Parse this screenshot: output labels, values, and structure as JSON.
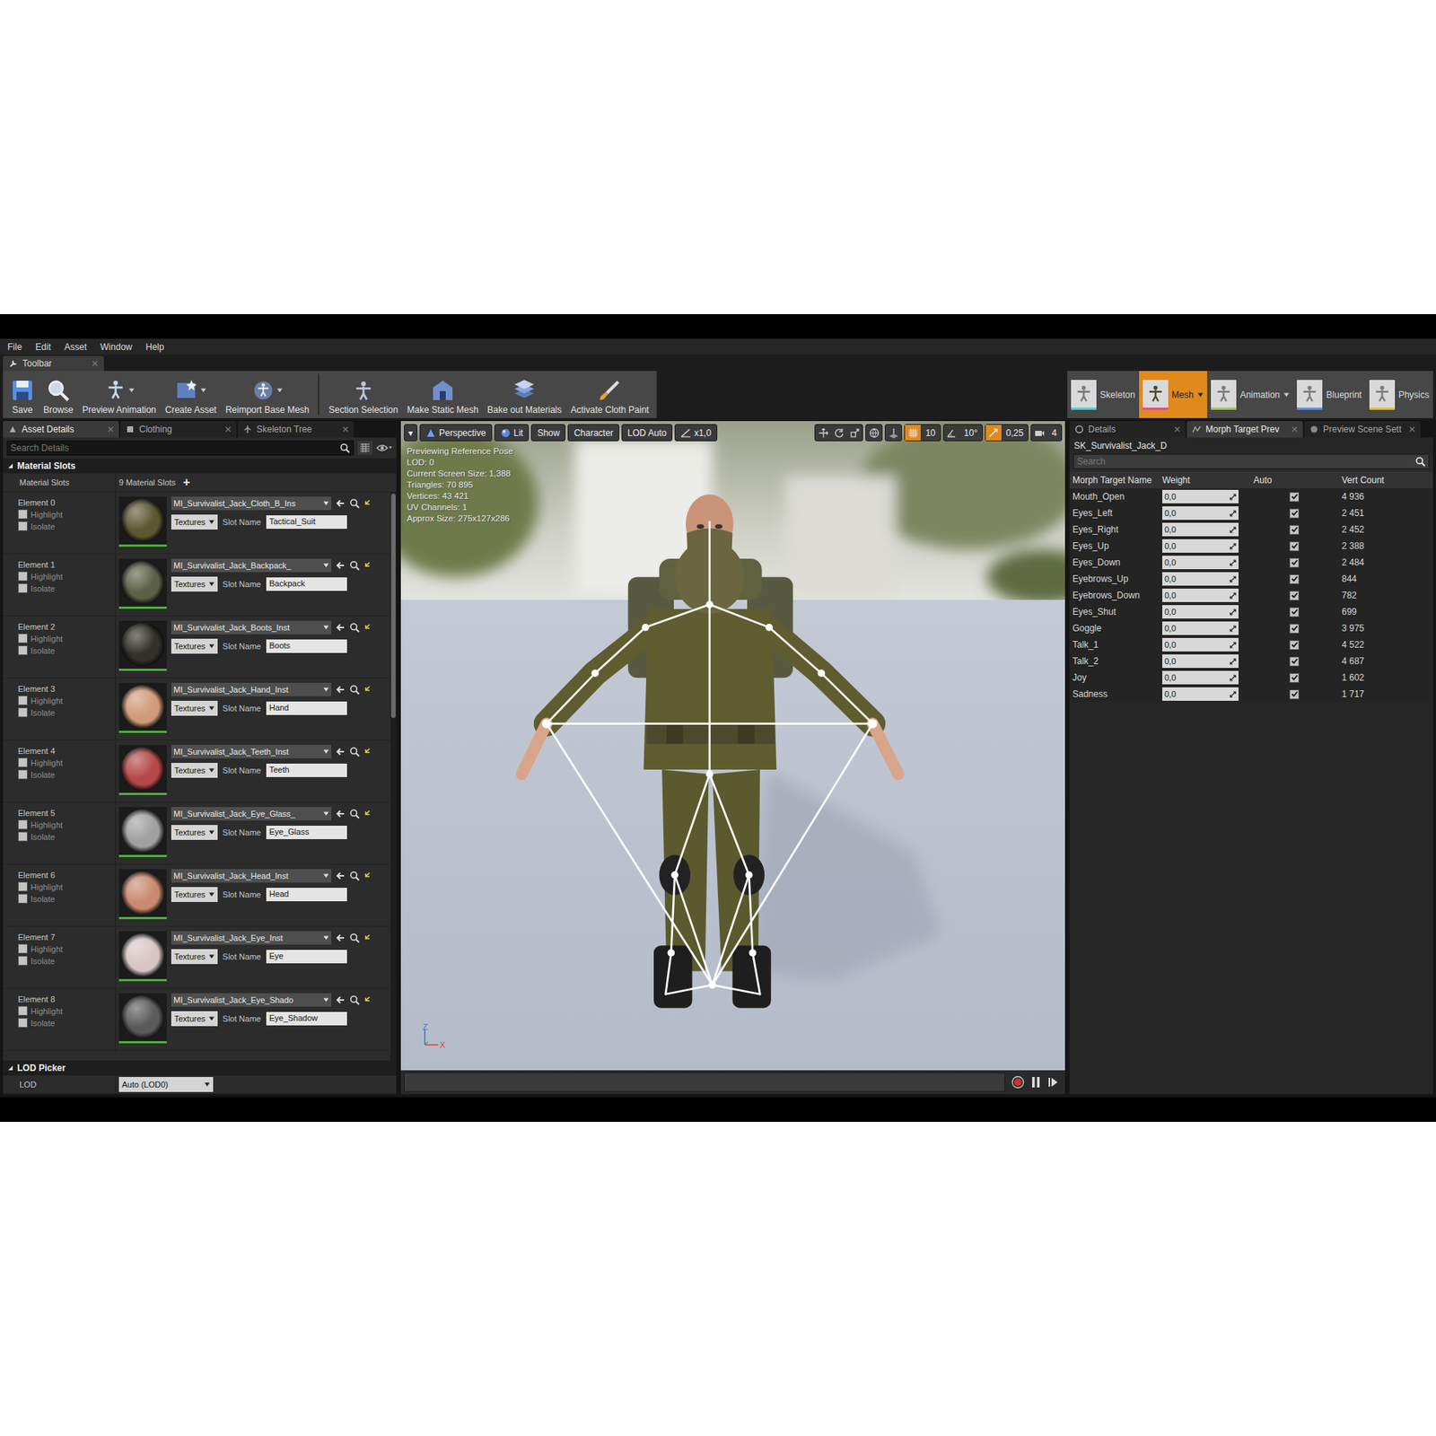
{
  "menu": [
    "File",
    "Edit",
    "Asset",
    "Window",
    "Help"
  ],
  "toolbar_tab": {
    "label": "Toolbar"
  },
  "toolbar_groups": [
    {
      "buttons": [
        {
          "label": "Save",
          "dropdown": false
        },
        {
          "label": "Browse",
          "dropdown": false
        },
        {
          "label": "Preview Animation",
          "dropdown": true
        },
        {
          "label": "Create Asset",
          "dropdown": true
        },
        {
          "label": "Reimport Base Mesh",
          "dropdown": true
        }
      ]
    },
    {
      "buttons": [
        {
          "label": "Section Selection",
          "dropdown": false
        },
        {
          "label": "Make Static Mesh",
          "dropdown": false
        },
        {
          "label": "Bake out Materials",
          "dropdown": false
        },
        {
          "label": "Activate Cloth Paint",
          "dropdown": false
        }
      ]
    }
  ],
  "modes": [
    {
      "label": "Skeleton",
      "selected": false,
      "dropdown": false
    },
    {
      "label": "Mesh",
      "selected": true,
      "dropdown": true
    },
    {
      "label": "Animation",
      "selected": false,
      "dropdown": true
    },
    {
      "label": "Blueprint",
      "selected": false,
      "dropdown": false
    },
    {
      "label": "Physics",
      "selected": false,
      "dropdown": false
    }
  ],
  "left_panel": {
    "tabs": [
      {
        "label": "Asset Details",
        "selected": true
      },
      {
        "label": "Clothing",
        "selected": false
      },
      {
        "label": "Skeleton Tree",
        "selected": false
      }
    ],
    "search": {
      "placeholder": "Search Details"
    },
    "material_section": {
      "title": "Material Slots",
      "expanded": true,
      "label": "Material Slots",
      "count": "9 Material Slots",
      "add": "+",
      "elements": [
        {
          "label": "Element 0",
          "highlight": {
            "label": "Highlight",
            "checked": false
          },
          "isolate": {
            "label": "Isolate",
            "checked": false
          },
          "material": "MI_Survivalist_Jack_Cloth_B_Ins",
          "textures": "Textures",
          "slot_label": "Slot Name",
          "slot_name": "Tactical_Suit",
          "color": "#5c5632"
        },
        {
          "label": "Element 1",
          "highlight": {
            "label": "Highlight",
            "checked": false
          },
          "isolate": {
            "label": "Isolate",
            "checked": false
          },
          "material": "MI_Survivalist_Jack_Backpack_",
          "textures": "Textures",
          "slot_label": "Slot Name",
          "slot_name": "Backpack",
          "color": "#5d6046"
        },
        {
          "label": "Element 2",
          "highlight": {
            "label": "Highlight",
            "checked": false
          },
          "isolate": {
            "label": "Isolate",
            "checked": false
          },
          "material": "MI_Survivalist_Jack_Boots_Inst",
          "textures": "Textures",
          "slot_label": "Slot Name",
          "slot_name": "Boots",
          "color": "#34302b"
        },
        {
          "label": "Element 3",
          "highlight": {
            "label": "Highlight",
            "checked": false
          },
          "isolate": {
            "label": "Isolate",
            "checked": false
          },
          "material": "MI_Survivalist_Jack_Hand_Inst",
          "textures": "Textures",
          "slot_label": "Slot Name",
          "slot_name": "Hand",
          "color": "#d19a78"
        },
        {
          "label": "Element 4",
          "highlight": {
            "label": "Highlight",
            "checked": false
          },
          "isolate": {
            "label": "Isolate",
            "checked": false
          },
          "material": "MI_Survivalist_Jack_Teeth_Inst",
          "textures": "Textures",
          "slot_label": "Slot Name",
          "slot_name": "Teeth",
          "color": "#b54848"
        },
        {
          "label": "Element 5",
          "highlight": {
            "label": "Highlight",
            "checked": false
          },
          "isolate": {
            "label": "Isolate",
            "checked": false
          },
          "material": "MI_Survivalist_Jack_Eye_Glass_",
          "textures": "Textures",
          "slot_label": "Slot Name",
          "slot_name": "Eye_Glass",
          "color": "#a0a0a0"
        },
        {
          "label": "Element 6",
          "highlight": {
            "label": "Highlight",
            "checked": false
          },
          "isolate": {
            "label": "Isolate",
            "checked": false
          },
          "material": "MI_Survivalist_Jack_Head_Inst",
          "textures": "Textures",
          "slot_label": "Slot Name",
          "slot_name": "Head",
          "color": "#c98a70"
        },
        {
          "label": "Element 7",
          "highlight": {
            "label": "Highlight",
            "checked": false
          },
          "isolate": {
            "label": "Isolate",
            "checked": false
          },
          "material": "MI_Survivalist_Jack_Eye_Inst",
          "textures": "Textures",
          "slot_label": "Slot Name",
          "slot_name": "Eye",
          "color": "#d8c6c6"
        },
        {
          "label": "Element 8",
          "highlight": {
            "label": "Highlight",
            "checked": false
          },
          "isolate": {
            "label": "Isolate",
            "checked": false
          },
          "material": "MI_Survivalist_Jack_Eye_Shado",
          "textures": "Textures",
          "slot_label": "Slot Name",
          "slot_name": "Eye_Shadow",
          "color": "#5a5a5a"
        }
      ]
    },
    "lod_section": {
      "title": "LOD Picker",
      "expanded": true,
      "label": "LOD",
      "value": "Auto (LOD0)"
    }
  },
  "viewport": {
    "toolbar": [
      {
        "label": "▾",
        "kind": "menu"
      },
      {
        "label": "Perspective",
        "kind": "icon-label"
      },
      {
        "label": "Lit",
        "kind": "icon-label"
      },
      {
        "label": "Show",
        "kind": "label"
      },
      {
        "label": "Character",
        "kind": "label"
      },
      {
        "label": "LOD Auto",
        "kind": "label"
      },
      {
        "label": "x1,0",
        "kind": "icon-label"
      }
    ],
    "snaps": [
      {
        "value": "10",
        "on": true
      },
      {
        "value": "10°",
        "on": false
      },
      {
        "value": "0,25",
        "on": true
      },
      {
        "value": "4",
        "on": false
      }
    ],
    "overlay": [
      "Previewing Reference Pose",
      "LOD: 0",
      "Current Screen Size: 1,388",
      "Triangles: 70 895",
      "Vertices: 43 421",
      "UV Channels: 1",
      "Approx Size: 275x127x286"
    ],
    "axes": {
      "z": "Z",
      "x": "X"
    }
  },
  "right_panel": {
    "tabs": [
      {
        "label": "Details",
        "selected": false
      },
      {
        "label": "Morph Target Prev",
        "selected": true
      },
      {
        "label": "Preview Scene Sett",
        "selected": false
      }
    ],
    "asset": "SK_Survivalist_Jack_D",
    "search": {
      "placeholder": "Search"
    },
    "columns": [
      "Morph Target Name",
      "Weight",
      "Auto",
      "Vert Count"
    ],
    "rows": [
      {
        "name": "Mouth_Open",
        "weight": "0,0",
        "auto": true,
        "verts": "4 936"
      },
      {
        "name": "Eyes_Left",
        "weight": "0,0",
        "auto": true,
        "verts": "2 451"
      },
      {
        "name": "Eyes_Right",
        "weight": "0,0",
        "auto": true,
        "verts": "2 452"
      },
      {
        "name": "Eyes_Up",
        "weight": "0,0",
        "auto": true,
        "verts": "2 388"
      },
      {
        "name": "Eyes_Down",
        "weight": "0,0",
        "auto": true,
        "verts": "2 484"
      },
      {
        "name": "Eyebrows_Up",
        "weight": "0,0",
        "auto": true,
        "verts": "844"
      },
      {
        "name": "Eyebrows_Down",
        "weight": "0,0",
        "auto": true,
        "verts": "782"
      },
      {
        "name": "Eyes_Shut",
        "weight": "0,0",
        "auto": true,
        "verts": "699"
      },
      {
        "name": "Goggle",
        "weight": "0,0",
        "auto": true,
        "verts": "3 975"
      },
      {
        "name": "Talk_1",
        "weight": "0,0",
        "auto": true,
        "verts": "4 522"
      },
      {
        "name": "Talk_2",
        "weight": "0,0",
        "auto": true,
        "verts": "4 687"
      },
      {
        "name": "Joy",
        "weight": "0,0",
        "auto": true,
        "verts": "1 602"
      },
      {
        "name": "Sadness",
        "weight": "0,0",
        "auto": true,
        "verts": "1 717"
      }
    ]
  }
}
